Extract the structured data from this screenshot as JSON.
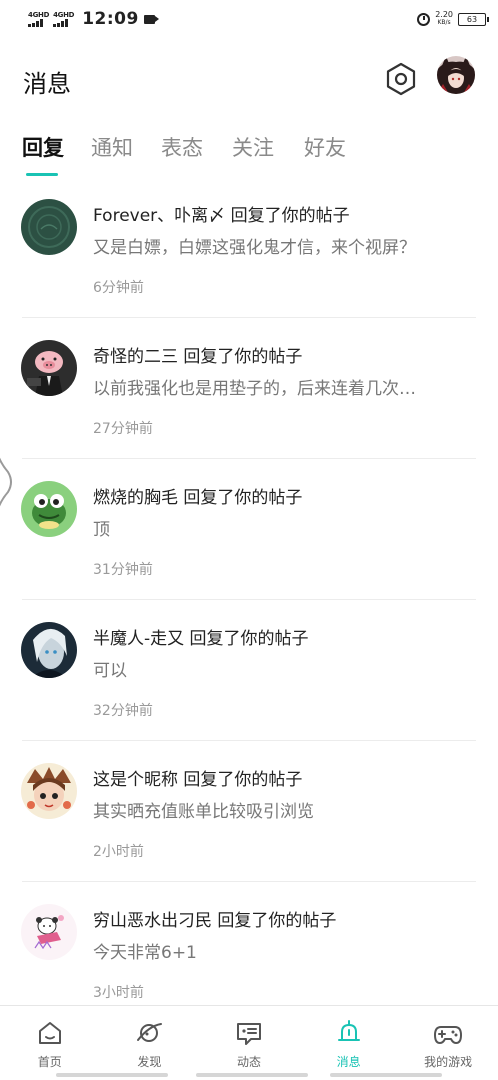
{
  "status_bar": {
    "signal1_label": "4GHD",
    "signal2_label": "4GHD",
    "time": "12:09",
    "net_speed": "2.20",
    "net_speed_unit": "KB/s",
    "battery": "63"
  },
  "header": {
    "title": "消息"
  },
  "tabs": [
    {
      "label": "回复",
      "active": true
    },
    {
      "label": "通知",
      "active": false
    },
    {
      "label": "表态",
      "active": false
    },
    {
      "label": "关注",
      "active": false
    },
    {
      "label": "好友",
      "active": false
    }
  ],
  "messages": [
    {
      "user": "Forever、卟离〆",
      "action": "回复了你的帖子",
      "body": "又是白嫖，白嫖这强化鬼才信，来个视屏？",
      "time": "6分钟前"
    },
    {
      "user": "奇怪的二三",
      "action": "回复了你的帖子",
      "body": "以前我强化也是用垫子的，后来连着几次…",
      "time": "27分钟前"
    },
    {
      "user": "燃烧的胸毛",
      "action": "回复了你的帖子",
      "body": "顶",
      "time": "31分钟前"
    },
    {
      "user": "半魔人-走又",
      "action": "回复了你的帖子",
      "body": "可以",
      "time": "32分钟前"
    },
    {
      "user": "这是个昵称",
      "action": "回复了你的帖子",
      "body": "其实晒充值账单比较吸引浏览",
      "time": "2小时前"
    },
    {
      "user": "穷山恶水出刁民",
      "action": "回复了你的帖子",
      "body": "今天非常6+1",
      "time": "3小时前"
    }
  ],
  "bottom_nav": [
    {
      "label": "首页",
      "icon": "home-icon",
      "active": false
    },
    {
      "label": "发现",
      "icon": "planet-icon",
      "active": false
    },
    {
      "label": "动态",
      "icon": "chat-icon",
      "active": false
    },
    {
      "label": "消息",
      "icon": "bell-icon",
      "active": true
    },
    {
      "label": "我的游戏",
      "icon": "gamepad-icon",
      "active": false
    }
  ],
  "colors": {
    "accent": "#19c3b4",
    "text_primary": "#222222",
    "text_secondary": "#777777",
    "text_muted": "#9a9a9a"
  }
}
